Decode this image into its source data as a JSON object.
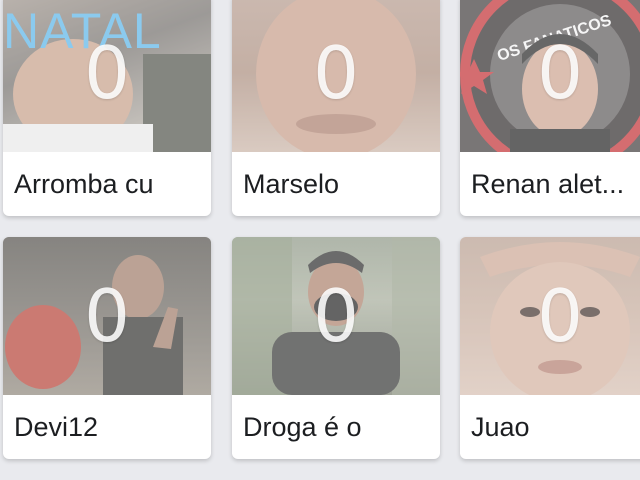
{
  "cards": [
    {
      "name": "Arromba cu",
      "count": "0",
      "overlay_text": "NATAL"
    },
    {
      "name": "Marselo",
      "count": "0"
    },
    {
      "name": "Renan alet...",
      "count": "0",
      "badge_text": "OS FANATICOS"
    },
    {
      "name": "Devi12",
      "count": "0"
    },
    {
      "name": "Droga é o",
      "count": "0"
    },
    {
      "name": "Juao",
      "count": "0"
    }
  ],
  "colors": {
    "background": "#e9eaee",
    "card": "#ffffff",
    "name_text": "#1c1e21",
    "overlay_text": "#55b2e6"
  }
}
